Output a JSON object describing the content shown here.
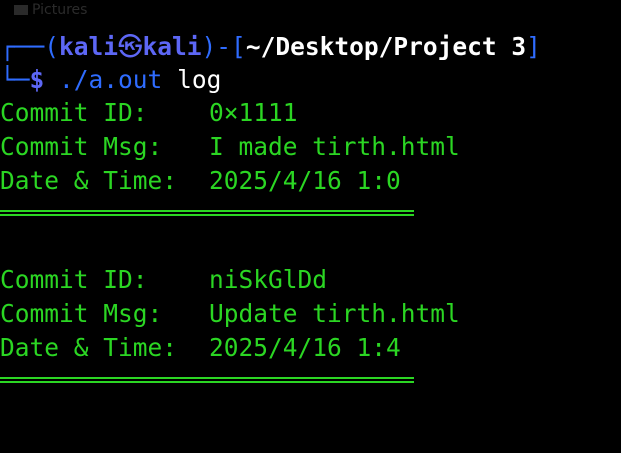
{
  "background_label": "Pictures",
  "prompt": {
    "frame_open": "┌──(",
    "user": "kali",
    "skull": "㉿",
    "host": "kali",
    "frame_mid": ")-[",
    "path": "~/Desktop/Project 3",
    "frame_close": "]",
    "line2_frame": "└─",
    "dollar": "$",
    "command": "./a.out",
    "args": "log"
  },
  "commits": [
    {
      "id_label": "Commit ID:",
      "id_value": "0×1111",
      "msg_label": "Commit Msg:",
      "msg_value": "I made tirth.html",
      "date_label": "Date & Time:",
      "date_value": "2025/4/16 1:0"
    },
    {
      "id_label": "Commit ID:",
      "id_value": "niSkGlDd",
      "msg_label": "Commit Msg:",
      "msg_value": "Update tirth.html",
      "date_label": "Date & Time:",
      "date_value": "2025/4/16 1:4"
    }
  ],
  "colors": {
    "background": "#000000",
    "output_text": "#2bd623",
    "prompt_frame": "#2f6cff",
    "prompt_user": "#5d67f5",
    "prompt_path": "#ffffff"
  }
}
